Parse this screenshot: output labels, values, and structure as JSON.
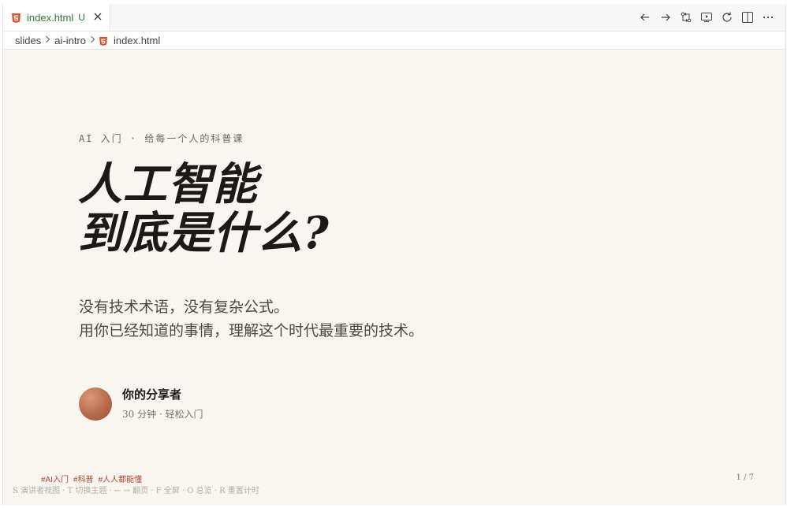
{
  "tab": {
    "file_name": "index.html",
    "status": "U"
  },
  "toolbar": {
    "icons": [
      "arrow-left-icon",
      "arrow-right-icon",
      "compare-changes-icon",
      "preview-icon",
      "refresh-icon",
      "split-editor-icon",
      "more-icon"
    ]
  },
  "breadcrumb": {
    "items": [
      "slides",
      "ai-intro",
      "index.html"
    ]
  },
  "slide": {
    "eyebrow": "AI 入门 · 给每一个人的科普课",
    "title_line1": "人工智能",
    "title_line2": "到底是什么?",
    "subtitle_line1": "没有技术术语，没有复杂公式。",
    "subtitle_line2": "用你已经知道的事情，理解这个时代最重要的技术。",
    "author_name": "你的分享者",
    "author_meta": "30 分钟 · 轻松入门",
    "tags": [
      "#AI入门",
      "#科普",
      "#人人都能懂"
    ],
    "hint": "S 演讲者视图 · T 切换主题 · ← → 翻页 · F 全屏 · O 总览 · R 重置计时",
    "pager": "1 / 7"
  },
  "colors": {
    "slide_background": "#f9f6f1",
    "accent": "#b0452a",
    "tab_text": "#2f7a2f",
    "html_icon": "#e44d26"
  }
}
